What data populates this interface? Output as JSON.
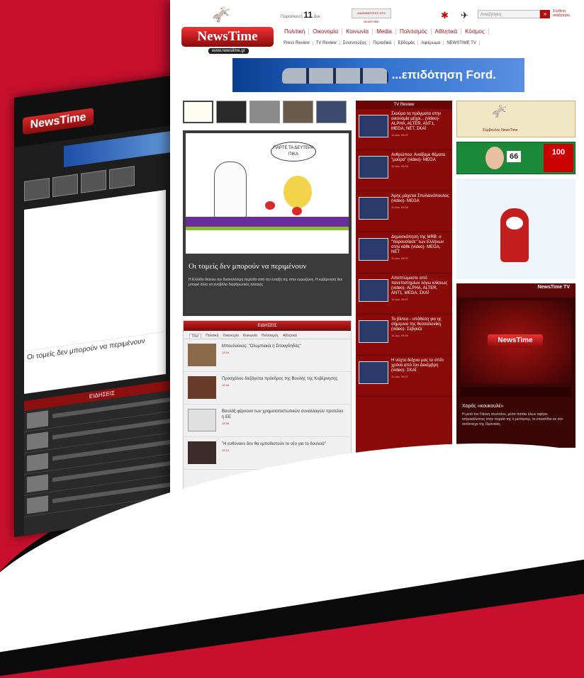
{
  "site": {
    "logo": "NewsTime",
    "url": "www.newstime.gr"
  },
  "back_page": {
    "logo": "NewsTime",
    "headline": "Οι τομείς δεν μπορούν να περιμένουν"
  },
  "header": {
    "date_prefix": "Παρασκευή",
    "date_day": "11",
    "date_month": "Δεκ",
    "top_box": "ΔΙΑΦΗΜΙΣΤΕΙΤΕ ΣΤΟ NEWSTIME",
    "search_placeholder": "Αναζήτηση",
    "search_advanced": "Σύνθετη αναζήτηση"
  },
  "nav_primary": [
    "Πολιτική",
    "Οικονομία",
    "Κοινωνία",
    "Media",
    "Πολιτισμός",
    "Αθλητικά",
    "Κόσμος"
  ],
  "nav_secondary": [
    "Press Review",
    "TV Review",
    "Συνεντεύξεις",
    "Περιοδικά",
    "Εβδομάς",
    "Αφιέρωμα",
    "NEWSTIME TV"
  ],
  "ad": {
    "text": "...επιδότηση Ford."
  },
  "feature": {
    "bubble": "ΠΑΡΤΕ ΤΑ ΔΕΥΤΕΡΑ ΠΙΚΑ",
    "title": "Οι τομείς δεν μπορούν να περιμένουν",
    "description": "Η Ελλάδα διανύει την δυσκολότερη περίοδο από την ένταξή της στην ευρωζώνη. Η κυβέρνηση δεν μπορεί άλλο να αναβάλει διαρθρωτικές αλλαγές"
  },
  "news": {
    "header": "ΕΙΔΗΣΕΙΣ",
    "tabs": [
      "Όλα",
      "Πολιτική",
      "Οικονομία",
      "Κοινωνία",
      "Πολιτισμός",
      "Αθλητικά"
    ],
    "items": [
      {
        "title": "Μπουλούκος: \"Ολυμπιακά η Σπουγδηδάς\"",
        "time": "12:24",
        "color": "#8a6a4a"
      },
      {
        "title": "Προσχόλου διεξάγεται πρόεδρος της Βουλής της Κυβέρνησης",
        "time": "12:16",
        "color": "#6a3a2a"
      },
      {
        "title": "Βουλάξ φέρνουν των χρηματοπιστωτικών συναλλαγών προτείνει η ΕΕ",
        "time": "12:18",
        "color": "#e0e0e0"
      },
      {
        "title": "\"Η ευθύνουν δεν θα εμποδιστούν το νέο για το δουλειά\"",
        "time": "12:14",
        "color": "#3a2a2a"
      }
    ]
  },
  "tv_review": {
    "header": "TV Review",
    "items": [
      {
        "title": "Σκούρα τα πράγματα στην οικονομία μέχρι... (video)- ALPHA, ALTER, ANT1, MEGA, NET, ΣΚΑΪ",
        "time": "11.Δεκ. 09:07"
      },
      {
        "title": "Ανθρώπου: Ανοίξαμε θέματα \"μαύρα\" (video)- MEGA",
        "time": "11.Δεκ. 09:00"
      },
      {
        "title": "Άρης μάχεται Σπυλιανόπουλος (video)- MEGA",
        "time": "11.Δεκ. 09:05"
      },
      {
        "title": "Δημοσκόπηση της MRB: ο \"παρουσίασε\" των Ελλήνων στην κάθε (video)- MEGA, NET",
        "time": "11.Δεκ. 09:07"
      },
      {
        "title": "Αποπτώμαστε από πανεπιστημίων λόγω κλίσεως (video)- ALPHA, ALTER, ANT1, MEGA, ΣΚΑΪ",
        "time": "11.Δεκ. 09:07"
      },
      {
        "title": "Το βίντεο - υπόθεση για ης σήμερινα της θεσσαλονίκη (video)- Σεβγκέλ",
        "time": "11.Δεκ. 09:00"
      },
      {
        "title": "Η νύχτα δείχνει μας το σπίτι χρόνο από τον Δεκέμβρη (video)- ΣΚΑΪ",
        "time": "11.Δεκ. 09:07"
      }
    ]
  },
  "right": {
    "banner1_text": "Σύμβουλος NewsTime",
    "banner2_num": "66",
    "banner2_red": "100",
    "tv": {
      "logo": "NewsTime",
      "logo_tag": "TV",
      "screen_logo": "NewsTime",
      "title": "Χορός «κουκουλέ»",
      "desc": "Η μετά τον Γιάννη σουλτάνο, μέσα πατάει όλων αφήνει απροκάλυπτες στην πορεία της η ρεπόρτερ, το επεισόδιο σε στο αντίστοιχο της Ομονοίας."
    }
  }
}
